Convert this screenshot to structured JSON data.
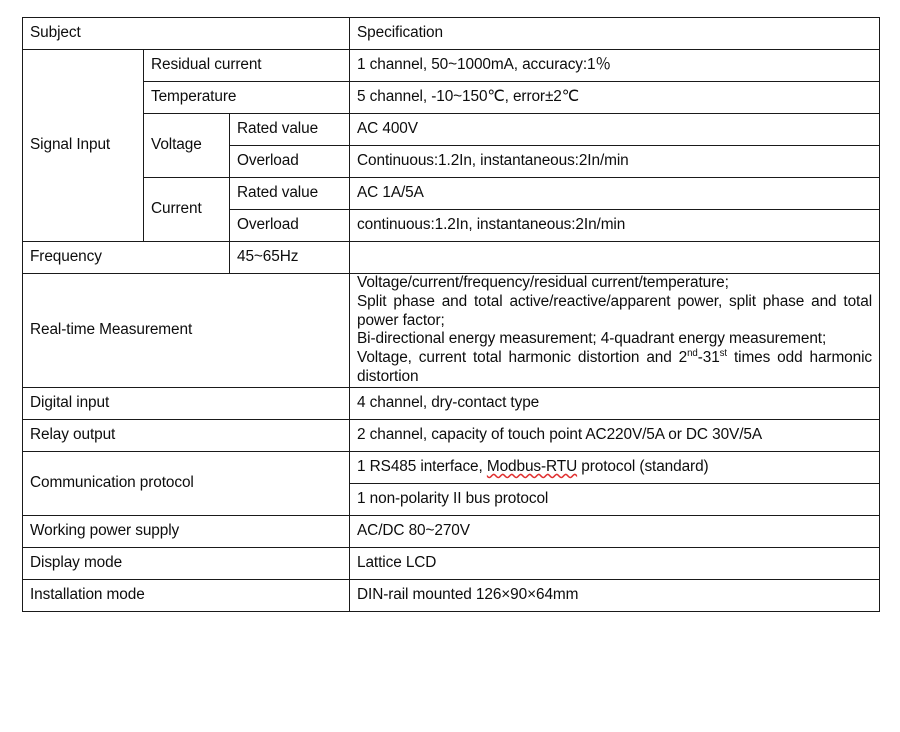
{
  "table": {
    "header": {
      "subject": "Subject",
      "specification": "Specification"
    },
    "signal_input": {
      "label": "Signal Input",
      "residual_current": {
        "label": "Residual current",
        "spec": "1 channel, 50~1000mA, accuracy:1％"
      },
      "temperature": {
        "label": "Temperature",
        "spec": "5 channel, -10~150℃, error±2℃"
      },
      "voltage": {
        "label": "Voltage",
        "rated_label": "Rated value",
        "rated_spec": "AC 400V",
        "overload_label": "Overload",
        "overload_spec": "Continuous:1.2In, instantaneous:2In/min"
      },
      "current": {
        "label": "Current",
        "rated_label": "Rated value",
        "rated_spec": "AC 1A/5A",
        "overload_label": "Overload",
        "overload_spec": "continuous:1.2In, instantaneous:2In/min"
      },
      "frequency": {
        "label": "Frequency",
        "spec": "45~65Hz"
      }
    },
    "realtime_measurement": {
      "label": "Real-time Measurement",
      "line1": "Voltage/current/frequency/residual current/temperature;",
      "line2": "Split phase and total active/reactive/apparent power, split phase and total power factor;",
      "line3": "Bi-directional energy measurement; 4-quadrant energy measurement;",
      "line4_a": "Voltage, current total harmonic distortion and 2",
      "line4_sup1": "nd",
      "line4_b": "-31",
      "line4_sup2": "st",
      "line4_c": " times odd harmonic distortion"
    },
    "digital_input": {
      "label": "Digital input",
      "spec": "4 channel, dry-contact type"
    },
    "relay_output": {
      "label": "Relay output",
      "spec": "2 channel, capacity of touch point AC220V/5A or DC 30V/5A"
    },
    "communication_protocol": {
      "label": "Communication protocol",
      "spec_line1_a": "1 RS485 interface, ",
      "spec_line1_misspelled": "Modbus-RTU",
      "spec_line1_b": " protocol (standard)",
      "spec_line2": "1 non-polarity II bus protocol"
    },
    "working_power_supply": {
      "label": "Working power supply",
      "spec": "AC/DC 80~270V"
    },
    "display_mode": {
      "label": "Display mode",
      "spec": "Lattice LCD"
    },
    "installation_mode": {
      "label": "Installation mode",
      "spec": "DIN-rail mounted 126×90×64mm"
    }
  },
  "colors": {
    "border": "#1a1a1a",
    "text": "#0d0d0d",
    "spellcheck_underline": "#e03030",
    "background": "#ffffff"
  }
}
